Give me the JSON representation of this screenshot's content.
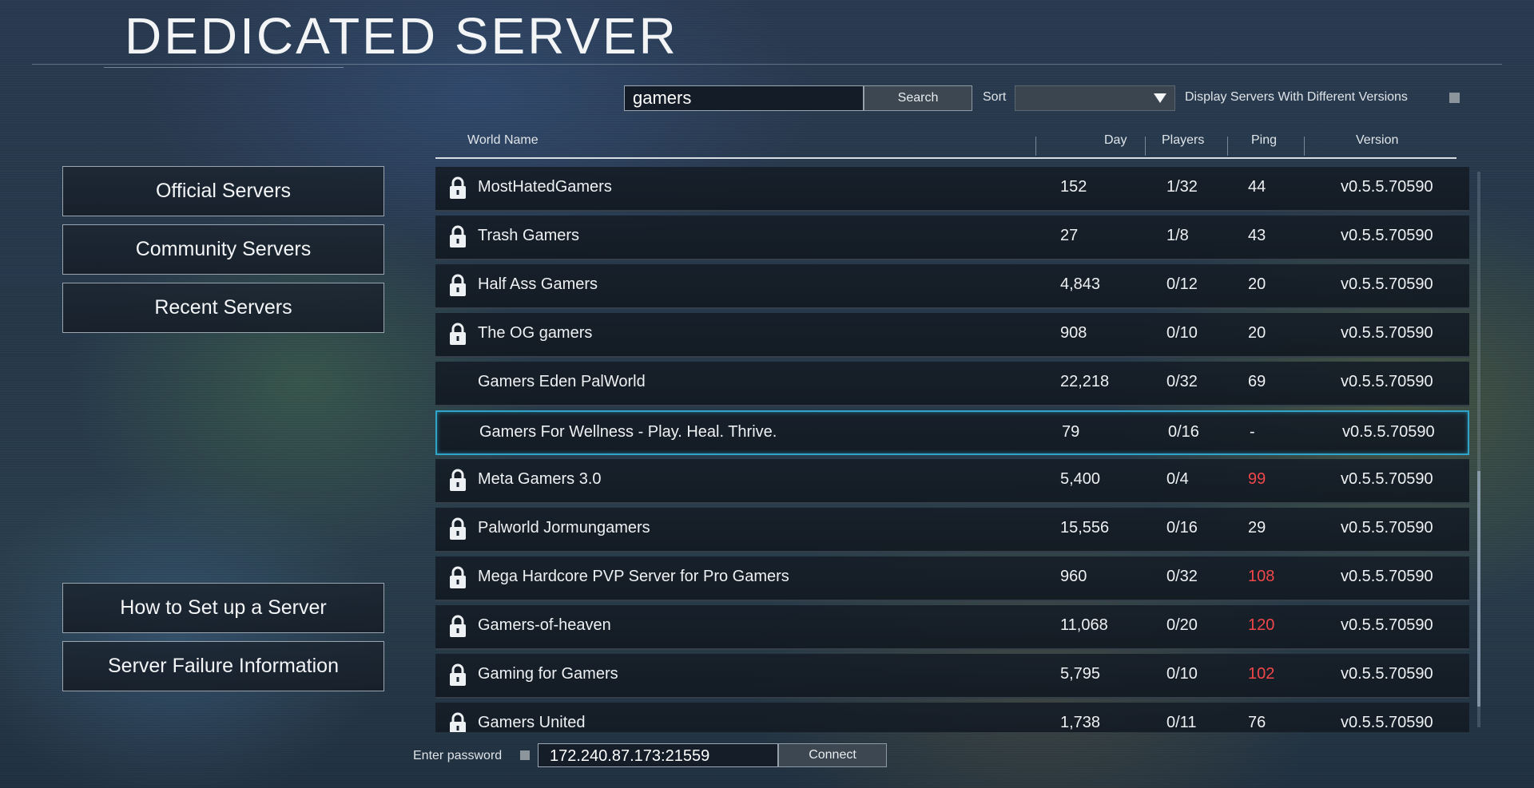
{
  "page_title": "DEDICATED SERVER",
  "search": {
    "value": "gamers",
    "button_label": "Search"
  },
  "sort": {
    "label": "Sort",
    "selected": ""
  },
  "display_versions": {
    "label": "Display Servers With Different Versions",
    "checked": false
  },
  "nav": {
    "official": "Official Servers",
    "community": "Community Servers",
    "recent": "Recent Servers",
    "how_to": "How to Set up a Server",
    "failure_info": "Server Failure Information"
  },
  "table": {
    "columns": [
      "World Name",
      "Day",
      "Players",
      "Ping",
      "Version"
    ],
    "rows": [
      {
        "locked": true,
        "name": "MostHatedGamers",
        "day": "152",
        "players": "1/32",
        "ping": "44",
        "ping_high": false,
        "version": "v0.5.5.70590"
      },
      {
        "locked": true,
        "name": "Trash Gamers",
        "day": "27",
        "players": "1/8",
        "ping": "43",
        "ping_high": false,
        "version": "v0.5.5.70590"
      },
      {
        "locked": true,
        "name": "Half Ass Gamers",
        "day": "4,843",
        "players": "0/12",
        "ping": "20",
        "ping_high": false,
        "version": "v0.5.5.70590"
      },
      {
        "locked": true,
        "name": "The OG gamers",
        "day": "908",
        "players": "0/10",
        "ping": "20",
        "ping_high": false,
        "version": "v0.5.5.70590"
      },
      {
        "locked": false,
        "name": "Gamers Eden PalWorld",
        "day": "22,218",
        "players": "0/32",
        "ping": "69",
        "ping_high": false,
        "version": "v0.5.5.70590"
      },
      {
        "locked": false,
        "name": "Gamers For Wellness - Play. Heal. Thrive.",
        "day": "79",
        "players": "0/16",
        "ping": "-",
        "ping_high": false,
        "version": "v0.5.5.70590",
        "selected": true
      },
      {
        "locked": true,
        "name": "Meta Gamers 3.0",
        "day": "5,400",
        "players": "0/4",
        "ping": "99",
        "ping_high": true,
        "version": "v0.5.5.70590"
      },
      {
        "locked": true,
        "name": "Palworld Jormungamers",
        "day": "15,556",
        "players": "0/16",
        "ping": "29",
        "ping_high": false,
        "version": "v0.5.5.70590"
      },
      {
        "locked": true,
        "name": "Mega Hardcore PVP Server for Pro Gamers",
        "day": "960",
        "players": "0/32",
        "ping": "108",
        "ping_high": true,
        "version": "v0.5.5.70590"
      },
      {
        "locked": true,
        "name": "Gamers-of-heaven",
        "day": "11,068",
        "players": "0/20",
        "ping": "120",
        "ping_high": true,
        "version": "v0.5.5.70590"
      },
      {
        "locked": true,
        "name": "Gaming for Gamers",
        "day": "5,795",
        "players": "0/10",
        "ping": "102",
        "ping_high": true,
        "version": "v0.5.5.70590"
      },
      {
        "locked": true,
        "name": "Gamers United",
        "day": "1,738",
        "players": "0/11",
        "ping": "76",
        "ping_high": false,
        "version": "v0.5.5.70590"
      }
    ]
  },
  "password": {
    "label": "Enter password",
    "checked": false
  },
  "address": {
    "value": "172.240.87.173:21559"
  },
  "connect_label": "Connect",
  "colors": {
    "selected_border": "#2fa4c8",
    "high_ping": "#f0474a"
  }
}
